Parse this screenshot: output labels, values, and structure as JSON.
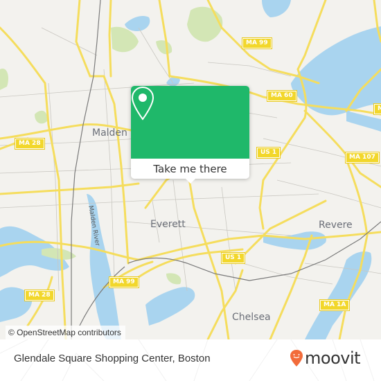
{
  "map": {
    "attribution": "© OpenStreetMap contributors",
    "places": [
      {
        "name": "Malden"
      },
      {
        "name": "Everett"
      },
      {
        "name": "Revere"
      },
      {
        "name": "Chelsea"
      }
    ],
    "water_labels": [
      {
        "name": "Malden River"
      }
    ],
    "route_shields": [
      {
        "label": "MA 99"
      },
      {
        "label": "MA 60"
      },
      {
        "label": "MA 28"
      },
      {
        "label": "US 1"
      },
      {
        "label": "MA 107"
      },
      {
        "label": "US 1"
      },
      {
        "label": "MA 28"
      },
      {
        "label": "MA 99"
      },
      {
        "label": "MA 1A"
      },
      {
        "label": "M"
      }
    ],
    "colors": {
      "land": "#f3f2ee",
      "water": "#a9d4ef",
      "park": "#d3e6b5",
      "major_road": "#f5dd5d",
      "minor_road": "#c9c7c1",
      "rail": "#7a7a7a"
    }
  },
  "popup": {
    "icon": "location-pin-icon",
    "button_label": "Take me there",
    "color": "#1fb86a"
  },
  "footer": {
    "title": "Glendale Square Shopping Center, Boston",
    "brand": "moovit",
    "brand_color": "#f26b3a"
  }
}
